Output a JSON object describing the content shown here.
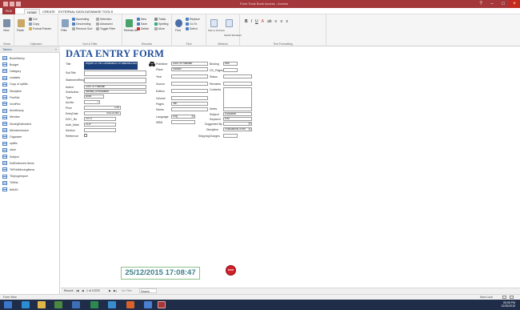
{
  "window": {
    "title": "Form Tools  Book Access - Access"
  },
  "tabs": [
    "FILE",
    "HOME",
    "CREATE",
    "EXTERNAL DATA",
    "DATABASE TOOLS"
  ],
  "ribbon": {
    "groups": [
      "Views",
      "Clipboard",
      "Sort & Filter",
      "Records",
      "Find",
      "Window",
      "Text Formatting"
    ],
    "view_label": "View",
    "paste_label": "Paste",
    "cut_label": "Cut",
    "copy_label": "Copy",
    "format_painter_label": "Format Painter",
    "filter_label": "Filter",
    "ascending_label": "Ascending",
    "descending_label": "Descending",
    "remove_sort_label": "Remove Sort",
    "selection_label": "Selection",
    "advanced_label": "Advanced",
    "toggle_filter_label": "Toggle Filter",
    "refresh_label": "Refresh All",
    "new_label": "New",
    "save_label": "Save",
    "delete_label": "Delete",
    "totals_label": "Totals",
    "spelling_label": "Spelling",
    "more_label": "More",
    "find_label": "Find",
    "replace_label": "Replace",
    "goto_label": "Go To",
    "select_label": "Select",
    "size_label": "Size to Fit Form",
    "switch_label": "Switch Windows"
  },
  "nav": {
    "header": "Tables",
    "items": [
      "BookHistory",
      "Budget",
      "Category",
      "contacts",
      "Copy of upkills",
      "Discipline",
      "FineTab",
      "InvoiRec",
      "ItemHistory",
      "Member",
      "MovingEstimated",
      "MemberInvoice",
      "Organizer",
      "upkills",
      "store",
      "Subject",
      "SoftDelivered Items",
      "TbPrintMovingItems",
      "Tblprogrimport",
      "Tblfind",
      "tblfuS1"
    ]
  },
  "form": {
    "title": "DATA ENTRY FORM",
    "labels": {
      "title": "Title",
      "subtitle": "SubTitle",
      "statement": "StatementResp",
      "author": "Author",
      "subauthor": "SubAuthor",
      "type": "Type",
      "accno": "AccNo",
      "price": "Price",
      "entrydate": "EntryDate",
      "doc_no": "DOC_No",
      "auth_mark": "Auth_Mark",
      "section": "Section",
      "reference": "Reference",
      "publisher": "Publisher",
      "place": "Place",
      "year": "Year",
      "source": "Source",
      "edition": "Edition",
      "volume": "Volume",
      "pages": "Pages",
      "series": "Series",
      "language": "Language",
      "isbn": "ISBN",
      "binding": "Binding",
      "cd_pages": "CD_Pages",
      "status": "Status",
      "remarks": "Remarks",
      "contents": "Contents",
      "notes": "Notes",
      "subject": "Subject",
      "keyword": "Keyword",
      "suggested": "Suggested By",
      "discipline": "Discipline",
      "shipping": "ShippingCharges"
    },
    "values": {
      "title": "Report Of The Commission On National Education",
      "subtitle": "",
      "statement": "",
      "author": "Govt. of Pakistan",
      "subauthor": "Ministry of education",
      "type": "Book",
      "accno": "1",
      "price": "2.50",
      "entrydate": "05/11/1982",
      "doc_no": "370.0",
      "auth_mark": "GOP",
      "section": "",
      "publisher": "Govt. of Pakistan",
      "place": "Karachi",
      "year": "",
      "source": "",
      "edition": "",
      "volume": "",
      "pages": "360",
      "series": "",
      "language": "Eng",
      "isbn": "",
      "binding": "Hbk",
      "cd_pages": "",
      "status": "",
      "remarks": "",
      "contents": "",
      "notes": "",
      "subject": "Education",
      "keyword": "Edu",
      "suggested": "",
      "discipline": "Publications of the",
      "shipping": ""
    }
  },
  "clock": "25/12/2015 17:08:47",
  "stop_label": "STOP",
  "record_nav": {
    "prefix": "Record: ",
    "position": "1 of 10378",
    "filter": "No Filter",
    "search": "Search"
  },
  "status": {
    "left": "Form View",
    "right": "Num Lock"
  },
  "tray": {
    "time": "05:08 PM",
    "date": "12/25/2015"
  },
  "colors": {
    "accent": "#a4373a",
    "form_title": "#1f4e9c",
    "clock_text": "#3e7f8a",
    "stop": "#d0202b",
    "taskbar": "#1f2d49"
  }
}
